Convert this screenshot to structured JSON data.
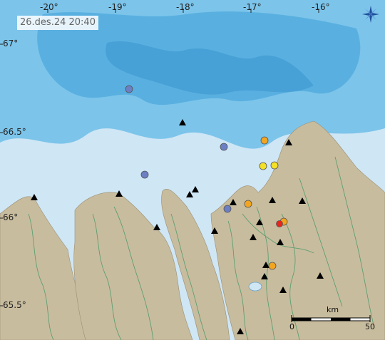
{
  "timestamp": "26.des.24  20:40",
  "longitude_labels": [
    "-20°",
    "-19°",
    "-18°",
    "-17°",
    "-16°"
  ],
  "latitude_labels": [
    "67°",
    "66.5°",
    "66°",
    "65.5°"
  ],
  "scale_bar": {
    "unit": "km",
    "start": "0",
    "end": "50"
  },
  "colors": {
    "sea_deep": "#4aa8dc",
    "sea_mid": "#7cc4ea",
    "sea_shallow": "#cfe6f5",
    "land": "#c8bc9e",
    "rivers": "#4b9a6a",
    "station": "#000000",
    "quake_old": "#6b7fc2",
    "quake_week": "#f2a620",
    "quake_recent": "#f4e026",
    "quake_hour": "#e8261e"
  },
  "compass_icon": "compass-icon",
  "stations_count_visible": 17,
  "earthquakes": [
    {
      "age": "old"
    },
    {
      "age": "old"
    },
    {
      "age": "old"
    },
    {
      "age": "old"
    },
    {
      "age": "week"
    },
    {
      "age": "week"
    },
    {
      "age": "week"
    },
    {
      "age": "week"
    },
    {
      "age": "recent"
    },
    {
      "age": "recent"
    },
    {
      "age": "hour"
    }
  ]
}
